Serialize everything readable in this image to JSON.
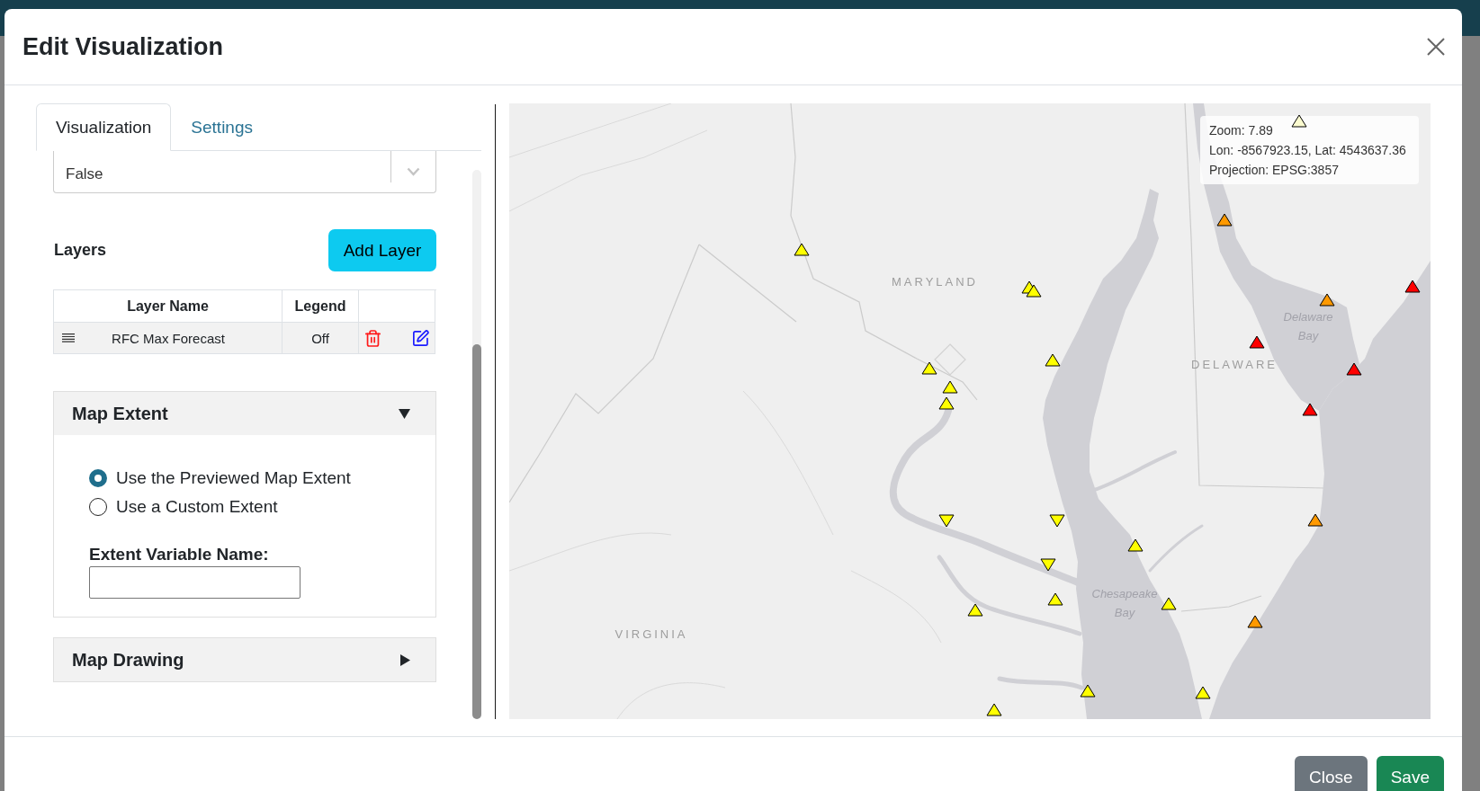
{
  "dialog": {
    "title": "Edit Visualization"
  },
  "tabs": [
    {
      "label": "Visualization",
      "selected": true
    },
    {
      "label": "Settings",
      "selected": false
    }
  ],
  "select": {
    "value": "False"
  },
  "layers": {
    "title": "Layers",
    "add_button": "Add Layer",
    "columns": [
      "Layer Name",
      "Legend"
    ],
    "rows": [
      {
        "name": "RFC Max Forecast",
        "legend": "Off"
      }
    ]
  },
  "sections": [
    {
      "title": "Map Extent",
      "expanded": true,
      "options": [
        {
          "label": "Use the Previewed Map Extent",
          "selected": true
        },
        {
          "label": "Use a Custom Extent",
          "selected": false
        }
      ],
      "field": {
        "label": "Extent Variable Name:"
      }
    },
    {
      "title": "Map Drawing",
      "expanded": false
    }
  ],
  "map": {
    "info": [
      "Zoom: 7.89",
      "Lon: -8567923.15, Lat: 4543637.36",
      "Projection: EPSG:3857"
    ],
    "labels": [
      {
        "text": "MARYLAND",
        "kind": "state"
      },
      {
        "text": "DELAWARE",
        "kind": "state"
      },
      {
        "text": "VIRGINIA",
        "kind": "state"
      },
      {
        "text": "Delaware Bay",
        "kind": "water"
      },
      {
        "text": "Chesapeake Bay",
        "kind": "water"
      }
    ],
    "markers": [
      {
        "color": "#fbfbcf",
        "kind": "up"
      },
      {
        "color": "#ff9900",
        "kind": "up"
      },
      {
        "color": "#ffff00",
        "kind": "up"
      },
      {
        "color": "#ff0000",
        "kind": "up"
      },
      {
        "color": "#ffff00",
        "kind": "up"
      },
      {
        "color": "#ffff00",
        "kind": "up"
      },
      {
        "color": "#ff9900",
        "kind": "up"
      },
      {
        "color": "#ff0000",
        "kind": "up"
      },
      {
        "color": "#ffff00",
        "kind": "up"
      },
      {
        "color": "#ffff00",
        "kind": "up"
      },
      {
        "color": "#ff0000",
        "kind": "up"
      },
      {
        "color": "#ffff00",
        "kind": "up"
      },
      {
        "color": "#ffff00",
        "kind": "up"
      },
      {
        "color": "#ff0000",
        "kind": "up"
      },
      {
        "color": "#ffff00",
        "kind": "down"
      },
      {
        "color": "#ffff00",
        "kind": "down"
      },
      {
        "color": "#ff9900",
        "kind": "up"
      },
      {
        "color": "#ffff00",
        "kind": "up"
      },
      {
        "color": "#ffff00",
        "kind": "down"
      },
      {
        "color": "#ffff00",
        "kind": "up"
      },
      {
        "color": "#ffff00",
        "kind": "up"
      },
      {
        "color": "#ffff00",
        "kind": "up"
      },
      {
        "color": "#ff9900",
        "kind": "up"
      },
      {
        "color": "#ffff00",
        "kind": "up"
      },
      {
        "color": "#ffff00",
        "kind": "up"
      },
      {
        "color": "#ffff00",
        "kind": "up"
      }
    ]
  },
  "footer": {
    "buttons": [
      {
        "label": "Close",
        "kind": "secondary"
      },
      {
        "label": "Save",
        "kind": "primary"
      }
    ]
  }
}
